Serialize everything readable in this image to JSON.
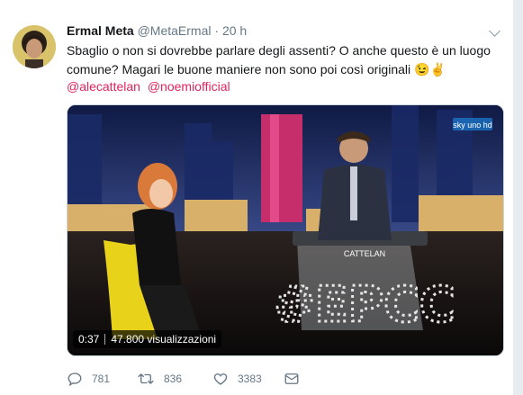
{
  "tweet": {
    "name": "Ermal Meta",
    "handle": "@MetaErmal",
    "separator": "·",
    "time": "20 h",
    "text": "Sbaglio o non si dovrebbe parlare degli assenti? O anche questo è un luogo comune? Magari le buone maniere non sono poi così originali",
    "emoji": "😉✌️",
    "mentions": [
      "@alecattelan",
      "@noemiofficial"
    ]
  },
  "video": {
    "duration": "0:37",
    "views": "47.800 visualizzazioni",
    "channel_logo": "sky uno hd",
    "stage_sign": "#EPCC",
    "desk_tag": "CATTELAN"
  },
  "actions": {
    "reply_count": "781",
    "retweet_count": "836",
    "like_count": "3383"
  },
  "colors": {
    "accent": "#e0245e",
    "secondary_text": "#657786",
    "background": "#e6ecf0"
  },
  "icons": [
    "chevron-down-icon",
    "reply-icon",
    "retweet-icon",
    "like-icon",
    "dm-icon"
  ]
}
